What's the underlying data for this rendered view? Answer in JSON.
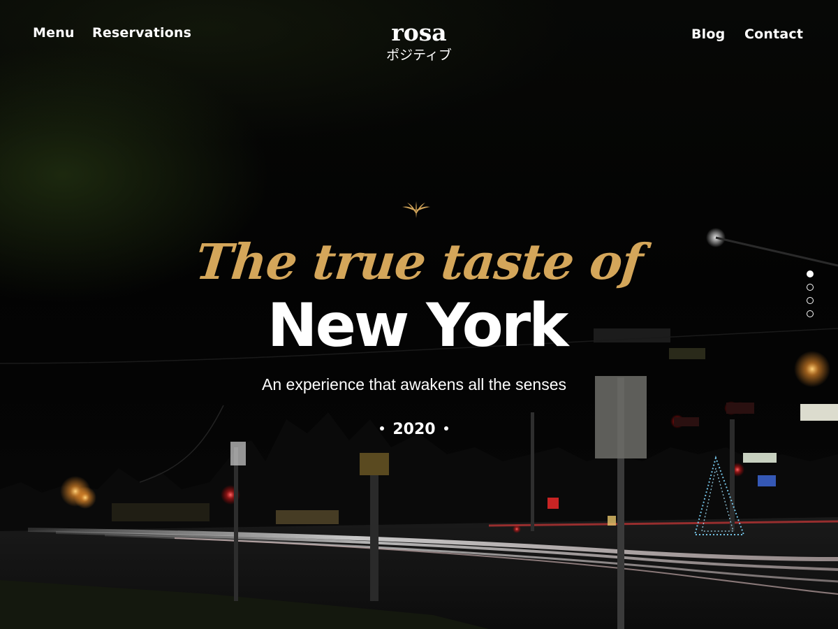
{
  "nav": {
    "left": [
      {
        "label": "Menu"
      },
      {
        "label": "Reservations"
      }
    ],
    "right": [
      {
        "label": "Blog"
      },
      {
        "label": "Contact"
      }
    ]
  },
  "logo": {
    "wordmark": "rosa",
    "subtitle": "ポジティブ"
  },
  "hero": {
    "script_line": "The true taste of",
    "headline": "New York",
    "subheadline": "An experience that awakens all the senses",
    "year": "2020"
  },
  "slider": {
    "total_slides": 4,
    "active_index": 0
  },
  "colors": {
    "accent_gold": "#d4a65a",
    "text": "#ffffff",
    "background": "#050505"
  },
  "icons": {
    "ornament": "ornamental-flourish-icon"
  }
}
